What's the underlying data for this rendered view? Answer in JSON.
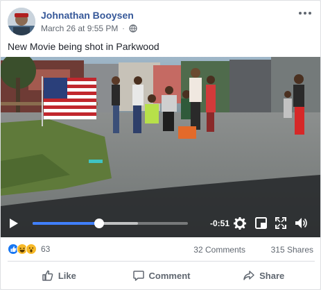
{
  "post": {
    "author": "Johnathan Booysen",
    "timestamp": "March 26 at 9:55 PM",
    "separator": "·",
    "privacy_icon": "globe-icon",
    "more_icon": "more-options-icon",
    "text": "New Movie being shot in Parkwood"
  },
  "video": {
    "progress_fraction": 0.43,
    "buffered_fraction": 0.68,
    "time_remaining": "-0:51",
    "controls": [
      "play-icon",
      "settings-gear-icon",
      "miniplayer-icon",
      "fullscreen-icon",
      "volume-icon"
    ]
  },
  "stats": {
    "reaction_icons": [
      "like-reaction-icon",
      "haha-reaction-icon",
      "wow-reaction-icon"
    ],
    "reaction_count": "63",
    "comments": "32 Comments",
    "shares": "315 Shares"
  },
  "actions": {
    "like": "Like",
    "comment": "Comment",
    "share": "Share"
  },
  "colors": {
    "author_link": "#365899",
    "accent": "#4080ff",
    "muted_text": "#606770",
    "like_blue": "#1877f2",
    "haha_yellow": "#f7b928"
  }
}
